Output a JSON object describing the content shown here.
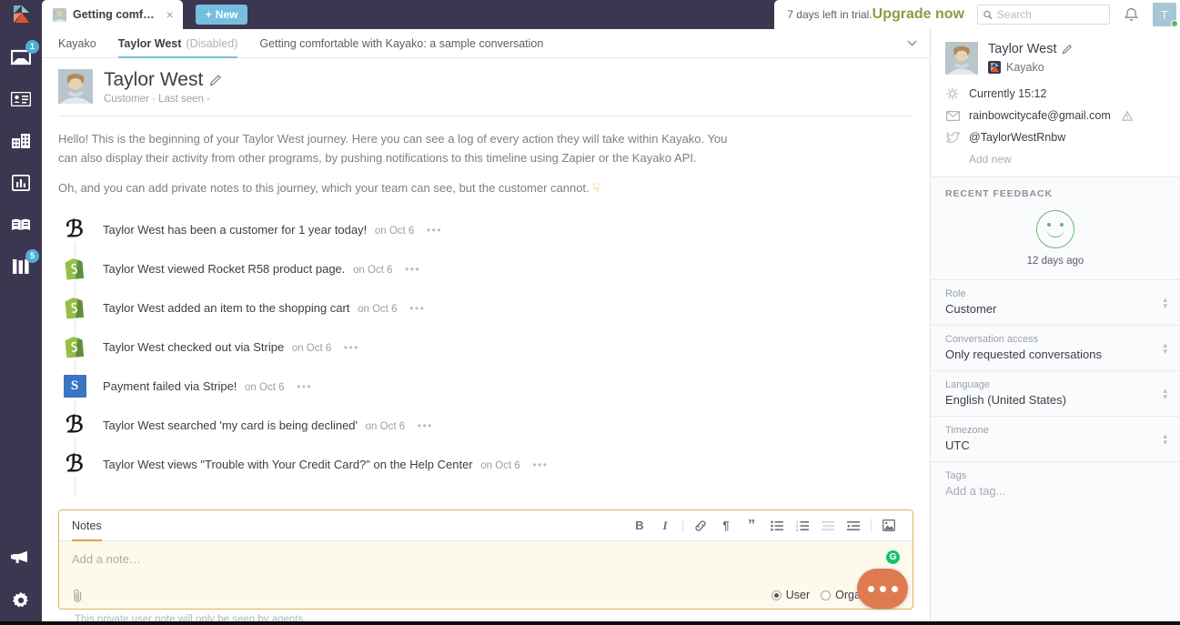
{
  "topbar": {
    "logo_icon": "kayako-logo",
    "browser_tab": {
      "title": "Getting comf…",
      "close_icon": "close-icon",
      "avatar_icon": "tab-avatar"
    },
    "new_button": {
      "label": "New",
      "plus": "+"
    },
    "trial_text": "7 days left in trial.",
    "trial_link": "Upgrade now",
    "search": {
      "placeholder": "Search",
      "value": "",
      "icon": "search-icon"
    },
    "bell_icon": "bell-icon",
    "me_avatar": {
      "initial": "T",
      "status": "online"
    }
  },
  "rail": {
    "items": [
      {
        "name": "inbox",
        "icon": "inbox-icon",
        "badge": "1"
      },
      {
        "name": "contacts",
        "icon": "contact-card-icon",
        "badge": ""
      },
      {
        "name": "organizations",
        "icon": "buildings-icon",
        "badge": ""
      },
      {
        "name": "reports",
        "icon": "bar-chart-icon",
        "badge": ""
      },
      {
        "name": "knowledge-base",
        "icon": "open-book-icon",
        "badge": ""
      },
      {
        "name": "boards",
        "icon": "columns-icon",
        "badge": "5"
      }
    ],
    "bottom": [
      {
        "name": "announcements",
        "icon": "megaphone-icon"
      },
      {
        "name": "settings",
        "icon": "gear-icon"
      }
    ]
  },
  "content_tabs": {
    "items": [
      {
        "label": "Kayako",
        "muted": "",
        "active": false
      },
      {
        "label": "Taylor West",
        "muted": "(Disabled)",
        "active": true
      },
      {
        "label": "Getting comfortable with Kayako: a sample conversation",
        "muted": "",
        "active": false
      }
    ],
    "chevron_icon": "chevron-down-icon"
  },
  "customer_header": {
    "name": "Taylor West",
    "edit_icon": "pencil-icon",
    "subtitle": "Customer · Last seen -"
  },
  "intro": {
    "paragraph1": "Hello! This is the beginning of your Taylor West journey. Here you can see a log of every action they will take within Kayako. You can also display their activity from other programs, by pushing notifications to this timeline using Zapier or the Kayako API.",
    "paragraph2": "Oh, and you can add private notes to this journey, which your team can see, but the customer cannot.",
    "hand_emoji": "☟"
  },
  "timeline": {
    "more_glyph": "•••",
    "events": [
      {
        "icon": "bigcommerce-icon",
        "text": "Taylor West has been a customer for 1 year today!",
        "date": "on Oct 6"
      },
      {
        "icon": "shopify-icon",
        "text": "Taylor West viewed Rocket R58 product page.",
        "date": "on Oct 6"
      },
      {
        "icon": "shopify-icon",
        "text": "Taylor West added an item to the shopping cart",
        "date": "on Oct 6"
      },
      {
        "icon": "shopify-icon",
        "text": "Taylor West checked out via Stripe",
        "date": "on Oct 6"
      },
      {
        "icon": "stripe-icon",
        "text": "Payment failed via Stripe!",
        "date": "on Oct 6"
      },
      {
        "icon": "bigcommerce-icon",
        "text": "Taylor West searched 'my card is being declined'",
        "date": "on Oct 6"
      },
      {
        "icon": "bigcommerce-icon",
        "text": "Taylor West views \"Trouble with Your Credit Card?\" on the Help Center",
        "date": "on Oct 6"
      }
    ]
  },
  "editor": {
    "tab_label": "Notes",
    "placeholder": "Add a note…",
    "value": "",
    "grammarly_icon": "grammarly-icon",
    "attach_icon": "paperclip-icon",
    "tools": [
      {
        "name": "bold-button",
        "glyph": "B"
      },
      {
        "name": "italic-button",
        "glyph": "I"
      },
      {
        "name": "link-button",
        "glyph": "link-icon"
      },
      {
        "name": "paragraph-button",
        "glyph": "¶"
      },
      {
        "name": "quote-button",
        "glyph": "”"
      },
      {
        "name": "bullet-list-button",
        "glyph": "bullet-list-icon"
      },
      {
        "name": "numbered-list-button",
        "glyph": "numbered-list-icon"
      },
      {
        "name": "outdent-button",
        "glyph": "outdent-icon"
      },
      {
        "name": "indent-button",
        "glyph": "indent-icon"
      },
      {
        "name": "insert-image-button",
        "glyph": "image-icon"
      }
    ],
    "radios": [
      {
        "label": "User",
        "selected": true
      },
      {
        "label": "Organization",
        "selected": false
      }
    ],
    "hint": "This private user note will only be seen by agents"
  },
  "right_panel": {
    "name": "Taylor West",
    "edit_icon": "pencil-icon",
    "org": "Kayako",
    "rows": [
      {
        "icon": "clock-icon",
        "text": "Currently 15:12",
        "warn": false
      },
      {
        "icon": "envelope-icon",
        "text": "rainbowcitycafe@gmail.com",
        "warn": true
      },
      {
        "icon": "twitter-icon",
        "text": "@TaylorWestRnbw",
        "warn": false
      }
    ],
    "add_new": "Add new",
    "feedback_title": "RECENT FEEDBACK",
    "feedback_icon": "smiley-happy-icon",
    "feedback_time": "12 days ago",
    "fields": [
      {
        "label": "Role",
        "value": "Customer",
        "placeholder": false
      },
      {
        "label": "Conversation access",
        "value": "Only requested conversations",
        "placeholder": false
      },
      {
        "label": "Language",
        "value": "English (United States)",
        "placeholder": false
      },
      {
        "label": "Timezone",
        "value": "UTC",
        "placeholder": false
      },
      {
        "label": "Tags",
        "value": "Add a tag...",
        "placeholder": true
      }
    ]
  },
  "fab": {
    "icon": "more-dots-icon"
  },
  "colors": {
    "rail_bg": "#3d3650",
    "accent_blue": "#76bedd",
    "note_border": "#d8b95f",
    "note_bg": "#fdf9ed",
    "fab": "#e07a50",
    "trial_link": "#8f9a3f",
    "badge": "#4eaed4"
  }
}
